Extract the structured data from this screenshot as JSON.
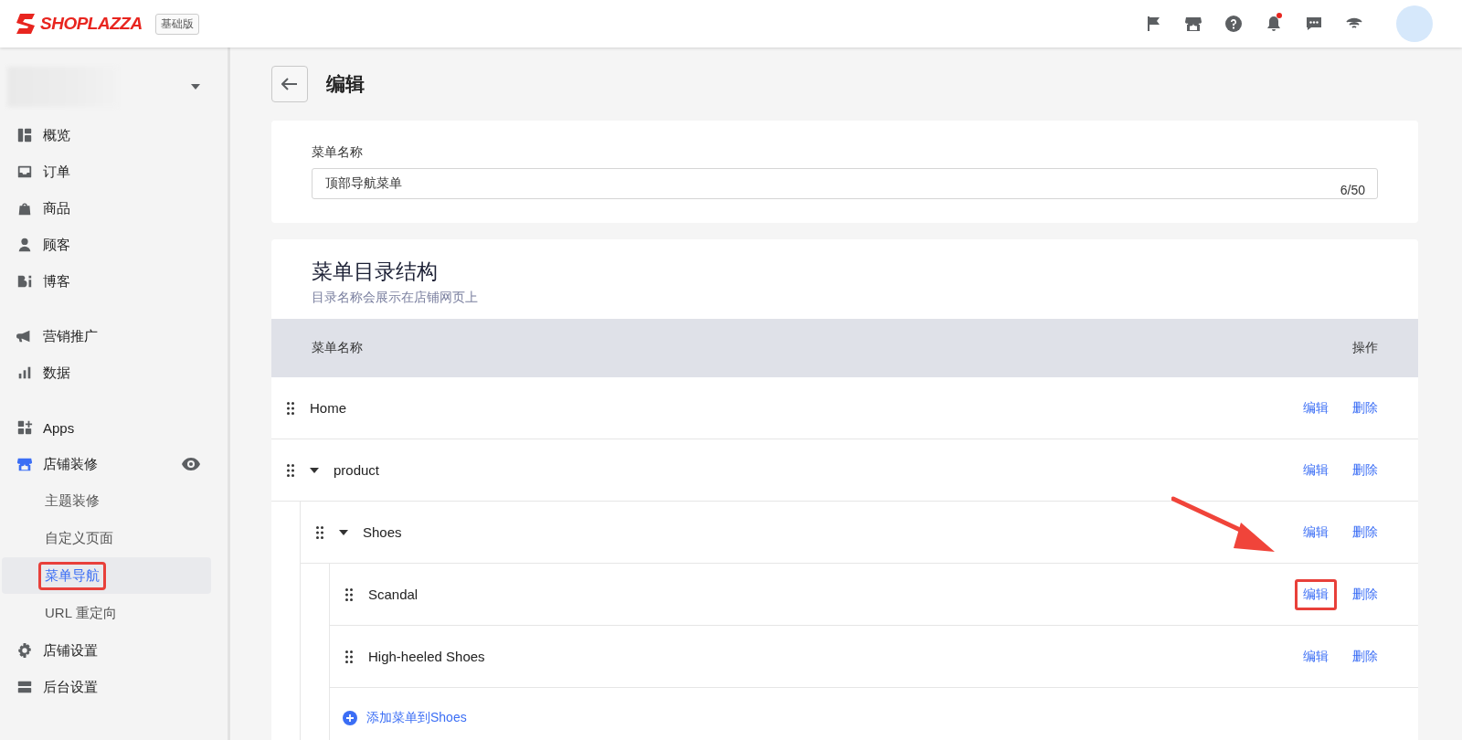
{
  "header": {
    "logo_text": "SHOPLAZZA",
    "plan_badge": "基础版",
    "has_notification": true
  },
  "sidebar": {
    "sections": [
      [
        {
          "label": "概览",
          "selected": false,
          "expanded": false
        },
        {
          "label": "订单",
          "selected": false,
          "expanded": false
        },
        {
          "label": "商品",
          "selected": false,
          "expanded": false
        },
        {
          "label": "顾客",
          "selected": false,
          "expanded": false
        },
        {
          "label": "博客",
          "selected": false,
          "expanded": false
        }
      ],
      [
        {
          "label": "营销推广",
          "selected": false,
          "expanded": false
        },
        {
          "label": "数据",
          "selected": false,
          "expanded": false
        }
      ],
      [
        {
          "label": "Apps",
          "selected": false,
          "expanded": false
        },
        {
          "label": "店铺装修",
          "selected": false,
          "expanded": true,
          "children": [
            {
              "label": "主题装修",
              "selected": false,
              "highlighted": false
            },
            {
              "label": "自定义页面",
              "selected": false,
              "highlighted": false
            },
            {
              "label": "菜单导航",
              "selected": true,
              "highlighted": true
            },
            {
              "label": "URL 重定向",
              "selected": false,
              "highlighted": false
            }
          ]
        },
        {
          "label": "店铺设置",
          "selected": false,
          "expanded": false
        },
        {
          "label": "后台设置",
          "selected": false,
          "expanded": false
        }
      ]
    ]
  },
  "page": {
    "title": "编辑",
    "name_field": {
      "label": "菜单名称",
      "value": "顶部导航菜单",
      "counter": "6/50"
    },
    "structure": {
      "title": "菜单目录结构",
      "subtitle": "目录名称会展示在店铺网页上",
      "columns": [
        "菜单名称",
        "操作"
      ],
      "rows": [
        {
          "name": "Home",
          "actions": [
            {
              "label": "编辑",
              "highlighted": false
            },
            {
              "label": "删除",
              "highlighted": false
            }
          ]
        },
        {
          "name": "product",
          "expanded": true,
          "actions": [
            {
              "label": "编辑",
              "highlighted": false
            },
            {
              "label": "删除",
              "highlighted": false
            }
          ],
          "children": [
            {
              "name": "Shoes",
              "expanded": true,
              "actions": [
                {
                  "label": "编辑",
                  "highlighted": false
                },
                {
                  "label": "删除",
                  "highlighted": false
                }
              ],
              "children": [
                {
                  "name": "Scandal",
                  "actions": [
                    {
                      "label": "编辑",
                      "highlighted": true
                    },
                    {
                      "label": "删除",
                      "highlighted": false
                    }
                  ]
                },
                {
                  "name": "High-heeled Shoes",
                  "actions": [
                    {
                      "label": "编辑",
                      "highlighted": false
                    },
                    {
                      "label": "删除",
                      "highlighted": false
                    }
                  ]
                }
              ],
              "add_link": "添加菜单到Shoes"
            }
          ]
        }
      ]
    }
  },
  "pointer_arrow": {
    "shown": true
  }
}
